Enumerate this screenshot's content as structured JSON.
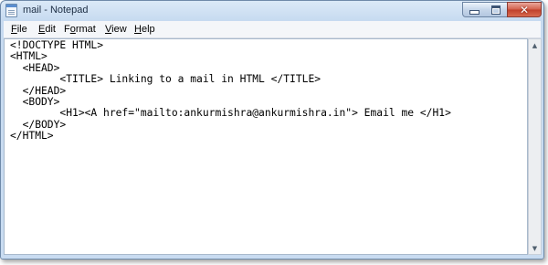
{
  "window": {
    "title": "mail - Notepad"
  },
  "menu": {
    "items": [
      {
        "label_u": "F",
        "label_rest": "ile"
      },
      {
        "label_u": "E",
        "label_rest": "dit"
      },
      {
        "label_pre": "F",
        "label_u": "o",
        "label_rest": "rmat"
      },
      {
        "label_u": "V",
        "label_rest": "iew"
      },
      {
        "label_u": "H",
        "label_rest": "elp"
      }
    ]
  },
  "editor": {
    "content": "<!DOCTYPE HTML>\n<HTML>\n  <HEAD>\n        <TITLE> Linking to a mail in HTML </TITLE>\n  </HEAD>\n  <BODY>\n        <H1><A href=\"mailto:ankurmishra@ankurmishra.in\"> Email me </H1>\n  </BODY>\n</HTML>"
  },
  "icons": {
    "app": "notepad-icon",
    "minimize": "minimize-icon",
    "maximize": "maximize-icon",
    "close": "close-icon",
    "scroll_up": "scroll-up-arrow-icon",
    "scroll_down": "scroll-down-arrow-icon"
  },
  "colors": {
    "titlebar": "#c6daf0",
    "close_button": "#c7442f",
    "editor_background": "#ffffff"
  }
}
